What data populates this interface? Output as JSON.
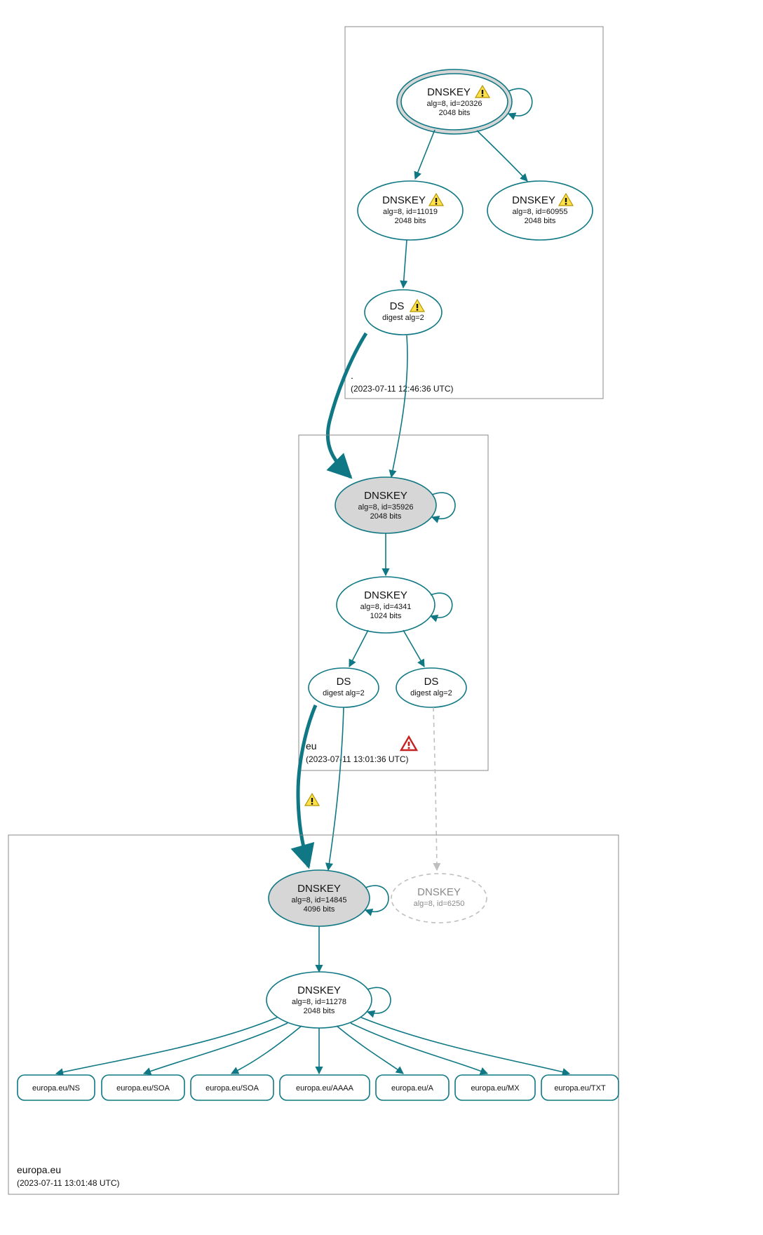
{
  "colors": {
    "stroke": "#0f7884",
    "sep": "#d6d6d6",
    "dim": "#bfbfbf"
  },
  "zones": {
    "root": {
      "label": ".",
      "ts": "(2023-07-11 12:46:36 UTC)"
    },
    "eu": {
      "label": "eu",
      "ts": "(2023-07-11 13:01:36 UTC)"
    },
    "europa": {
      "label": "europa.eu",
      "ts": "(2023-07-11 13:01:48 UTC)"
    }
  },
  "nodes": {
    "root_ksk": {
      "title": "DNSKEY",
      "l1": "alg=8, id=20326",
      "l2": "2048 bits",
      "warn": true
    },
    "root_zsk1": {
      "title": "DNSKEY",
      "l1": "alg=8, id=11019",
      "l2": "2048 bits",
      "warn": true
    },
    "root_zsk2": {
      "title": "DNSKEY",
      "l1": "alg=8, id=60955",
      "l2": "2048 bits",
      "warn": true
    },
    "root_ds": {
      "title": "DS",
      "l1": "digest alg=2",
      "warn": true
    },
    "eu_ksk": {
      "title": "DNSKEY",
      "l1": "alg=8, id=35926",
      "l2": "2048 bits"
    },
    "eu_zsk": {
      "title": "DNSKEY",
      "l1": "alg=8, id=4341",
      "l2": "1024 bits"
    },
    "eu_ds1": {
      "title": "DS",
      "l1": "digest alg=2"
    },
    "eu_ds2": {
      "title": "DS",
      "l1": "digest alg=2"
    },
    "eur_ksk": {
      "title": "DNSKEY",
      "l1": "alg=8, id=14845",
      "l2": "4096 bits"
    },
    "eur_ghost": {
      "title": "DNSKEY",
      "l1": "alg=8, id=6250"
    },
    "eur_zsk": {
      "title": "DNSKEY",
      "l1": "alg=8, id=11278",
      "l2": "2048 bits"
    }
  },
  "rr": {
    "r0": "europa.eu/NS",
    "r1": "europa.eu/SOA",
    "r2": "europa.eu/SOA",
    "r3": "europa.eu/AAAA",
    "r4": "europa.eu/A",
    "r5": "europa.eu/MX",
    "r6": "europa.eu/TXT"
  }
}
